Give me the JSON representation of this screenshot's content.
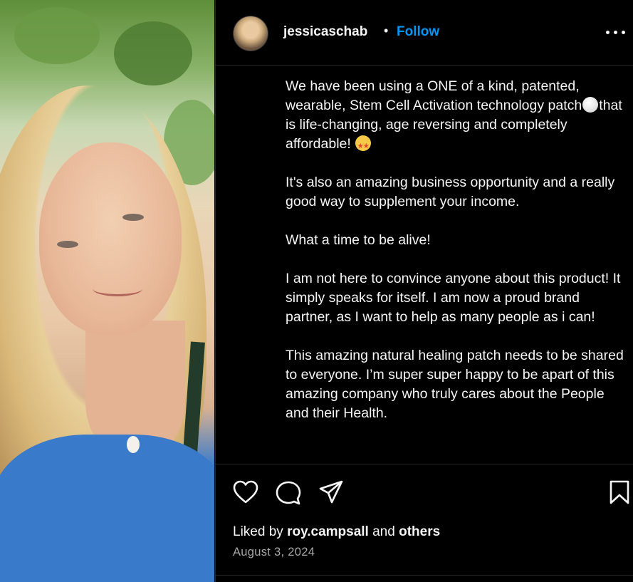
{
  "post": {
    "username": "jessicaschab",
    "separator": "•",
    "follow_label": "Follow",
    "caption": {
      "p1a": "We have been using a ONE of a kind, patented, wearable, Stem Cell Activation technology patch",
      "p1b": "that is life-changing, age reversing and completely affordable!",
      "p2": "It's also an amazing business opportunity and a really good way to supplement your income.",
      "p3": "What a time to be alive!",
      "p4": "I am not here to convince anyone about this product! It simply speaks for itself. I am now a proud brand partner, as I want to help as many people as i can!",
      "p5": "This amazing natural healing patch needs to be shared to everyone. I’m super super happy to be apart of this amazing company who truly cares about the People and their Health."
    },
    "likes": {
      "prefix": "Liked by",
      "user": "roy.campsall",
      "joiner": "and",
      "others": "others"
    },
    "date": "August 3, 2024"
  },
  "icons": [
    "heart-icon",
    "comment-icon",
    "share-icon",
    "bookmark-icon",
    "more-icon",
    "white-circle-emoji",
    "star-struck-emoji"
  ],
  "colors": {
    "background": "#000000",
    "text": "#f5f5f5",
    "accent": "#0095f6",
    "muted": "#a8a8a8",
    "divider": "#262626"
  }
}
